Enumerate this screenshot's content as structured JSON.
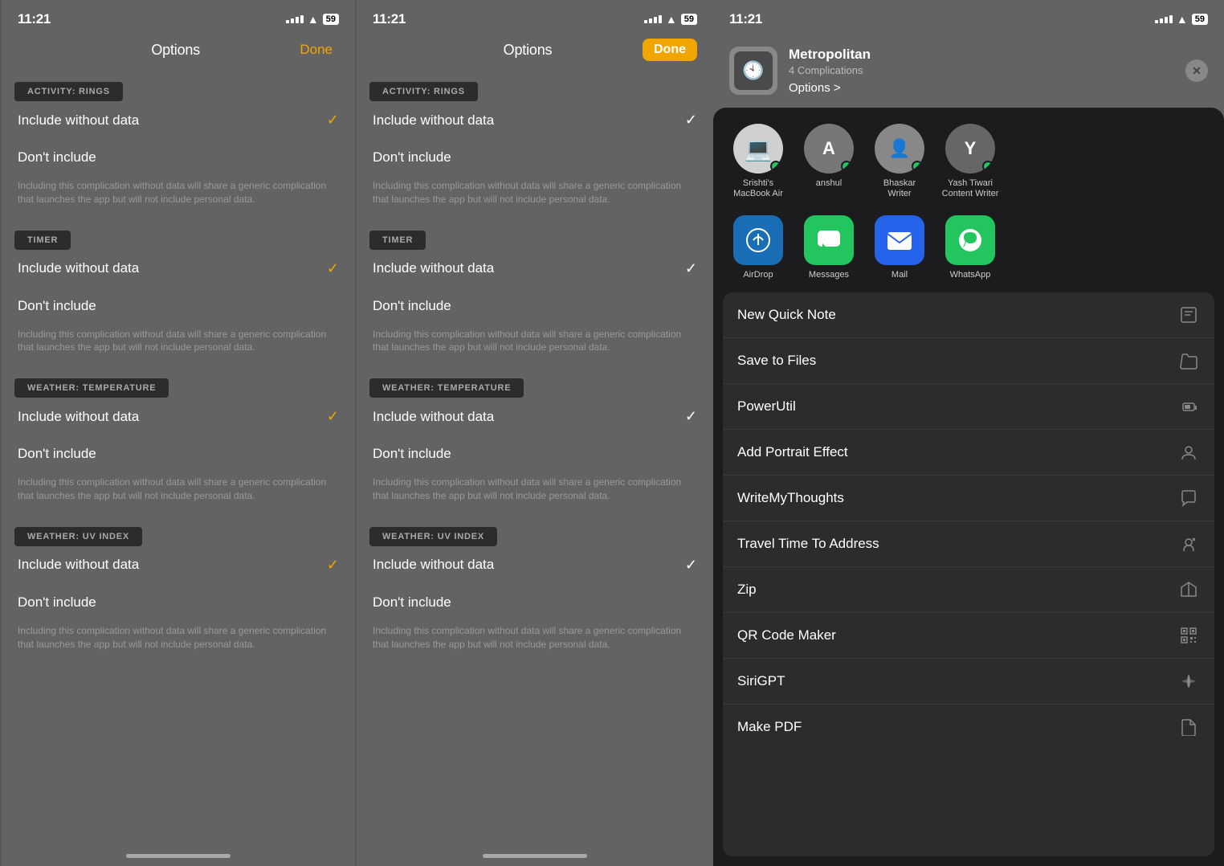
{
  "panel1": {
    "status": {
      "time": "11:21",
      "battery": "59"
    },
    "nav": {
      "title": "Options",
      "done": "Done"
    },
    "sections": [
      {
        "header": "ACTIVITY: RINGS",
        "options": [
          {
            "label": "Include without data",
            "checked": true
          },
          {
            "label": "Don't include",
            "checked": false
          }
        ],
        "note": "Including this complication without data will share a generic complication that launches the app but will not include personal data."
      },
      {
        "header": "TIMER",
        "options": [
          {
            "label": "Include without data",
            "checked": true
          },
          {
            "label": "Don't include",
            "checked": false
          }
        ],
        "note": "Including this complication without data will share a generic complication that launches the app but will not include personal data."
      },
      {
        "header": "WEATHER: TEMPERATURE",
        "options": [
          {
            "label": "Include without data",
            "checked": true
          },
          {
            "label": "Don't include",
            "checked": false
          }
        ],
        "note": "Including this complication without data will share a generic complication that launches the app but will not include personal data."
      },
      {
        "header": "WEATHER: UV INDEX",
        "options": [
          {
            "label": "Include without data",
            "checked": true
          },
          {
            "label": "Don't include",
            "checked": false
          }
        ],
        "note": "Including this complication without data will share a generic complication that launches the app but will not include personal data."
      }
    ]
  },
  "panel2": {
    "status": {
      "time": "11:21",
      "battery": "59"
    },
    "nav": {
      "title": "Options",
      "done": "Done"
    },
    "sections": [
      {
        "header": "ACTIVITY: RINGS",
        "options": [
          {
            "label": "Include without data",
            "checked": true
          },
          {
            "label": "Don't include",
            "checked": false
          }
        ],
        "note": "Including this complication without data will share a generic complication that launches the app but will not include personal data."
      },
      {
        "header": "TIMER",
        "options": [
          {
            "label": "Include without data",
            "checked": true
          },
          {
            "label": "Don't include",
            "checked": false
          }
        ],
        "note": "Including this complication without data will share a generic complication that launches the app but will not include personal data."
      },
      {
        "header": "WEATHER: TEMPERATURE",
        "options": [
          {
            "label": "Include without data",
            "checked": true
          },
          {
            "label": "Don't include",
            "checked": false
          }
        ],
        "note": "Including this complication without data will share a generic complication that launches the app but will not include personal data."
      },
      {
        "header": "WEATHER: UV INDEX",
        "options": [
          {
            "label": "Include without data",
            "checked": true
          },
          {
            "label": "Don't include",
            "checked": false
          }
        ],
        "note": "Including this complication without data will share a generic complication that launches the app but will not include personal data."
      }
    ]
  },
  "panel3": {
    "status": {
      "time": "11:21",
      "battery": "59"
    },
    "watch": {
      "name": "Metropolitan",
      "subtitle": "4 Complications",
      "options_link": "Options >"
    },
    "people": [
      {
        "name": "Srishti's\nMacBook Air",
        "type": "laptop",
        "online": true
      },
      {
        "name": "anshul",
        "type": "anshul",
        "initial": "A",
        "online": true
      },
      {
        "name": "Bhaskar\nWriter",
        "type": "bhaskar",
        "online": true
      },
      {
        "name": "Yash Tiwari\nContent Writer",
        "type": "yash",
        "initial": "Y",
        "online": true
      }
    ],
    "apps": [
      {
        "name": "AirDrop",
        "type": "airdrop"
      },
      {
        "name": "Messages",
        "type": "messages"
      },
      {
        "name": "Mail",
        "type": "mail"
      },
      {
        "name": "WhatsApp",
        "type": "whatsapp"
      }
    ],
    "menu_items": [
      {
        "label": "New Quick Note",
        "icon": "📝"
      },
      {
        "label": "Save to Files",
        "icon": "📁"
      },
      {
        "label": "PowerUtil",
        "icon": "🔋"
      },
      {
        "label": "Add Portrait Effect",
        "icon": "👤"
      },
      {
        "label": "WriteMyThoughts",
        "icon": "💬"
      },
      {
        "label": "Travel Time To Address",
        "icon": "🗺"
      },
      {
        "label": "Zip",
        "icon": "📦"
      },
      {
        "label": "QR Code Maker",
        "icon": "▦"
      },
      {
        "label": "SiriGPT",
        "icon": "🎙"
      },
      {
        "label": "Make PDF",
        "icon": "📄"
      }
    ]
  }
}
